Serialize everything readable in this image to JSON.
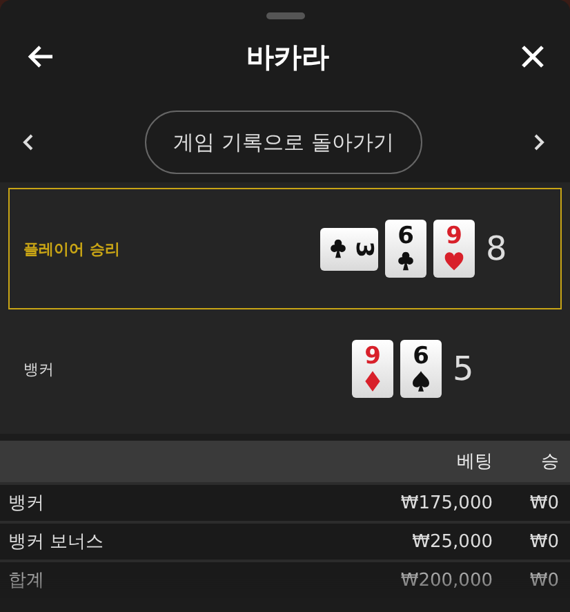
{
  "header": {
    "title": "바카라"
  },
  "nav": {
    "label": "게임 기록으로 돌아가기"
  },
  "hands": [
    {
      "label": "플레이어 승리",
      "winner": true,
      "score": "8",
      "cards": [
        {
          "rank": "3",
          "kind": "clubs",
          "rotated": true
        },
        {
          "rank": "6",
          "kind": "clubs",
          "rotated": false
        },
        {
          "rank": "9",
          "kind": "hearts",
          "rotated": false
        }
      ]
    },
    {
      "label": "뱅커",
      "winner": false,
      "score": "5",
      "cards": [
        {
          "rank": "9",
          "kind": "diamonds",
          "rotated": false
        },
        {
          "rank": "6",
          "kind": "spades",
          "rotated": false
        }
      ]
    }
  ],
  "table": {
    "columns": [
      "베팅",
      "승"
    ],
    "rows": [
      {
        "name": "뱅커",
        "bet": "₩175,000",
        "win": "₩0"
      },
      {
        "name": "뱅커 보너스",
        "bet": "₩25,000",
        "win": "₩0"
      },
      {
        "name": "합계",
        "bet": "₩200,000",
        "win": "₩0"
      }
    ]
  }
}
